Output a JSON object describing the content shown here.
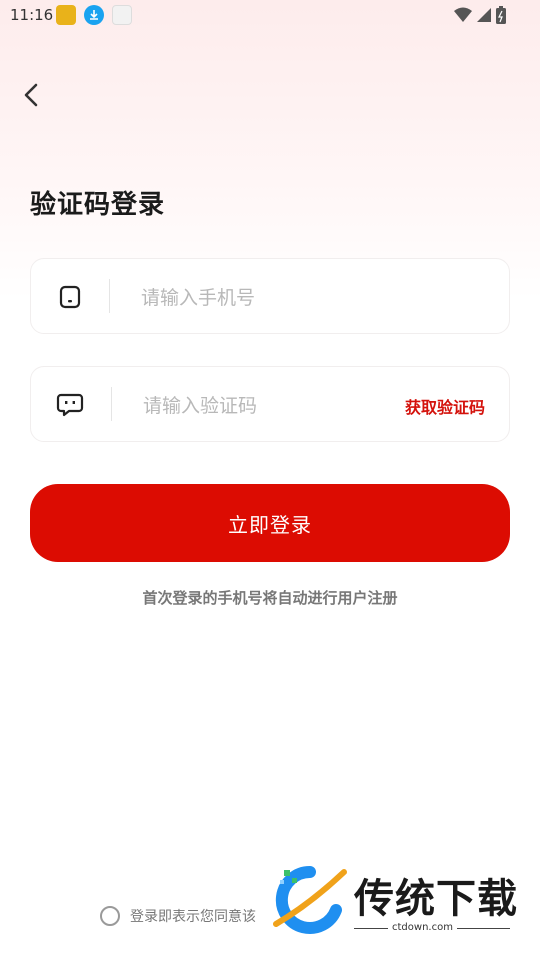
{
  "status_bar": {
    "time": "11:16",
    "notification_icons": [
      "app-badge-icon",
      "download-icon",
      "app-thumbnail-icon"
    ],
    "system_icons": [
      "wifi-icon",
      "signal-icon",
      "battery-icon"
    ]
  },
  "header": {
    "back_icon": "chevron-left-icon"
  },
  "page": {
    "title": "验证码登录"
  },
  "form": {
    "phone": {
      "icon": "phone-icon",
      "placeholder": "请输入手机号",
      "value": ""
    },
    "code": {
      "icon": "message-icon",
      "placeholder": "请输入验证码",
      "value": "",
      "get_code_label": "获取验证码"
    },
    "submit_label": "立即登录",
    "hint": "首次登录的手机号将自动进行用户注册"
  },
  "agreement": {
    "text": "登录即表示您同意该",
    "checked": false
  },
  "watermark": {
    "title": "传统下载",
    "url": "ctdown.com"
  },
  "colors": {
    "accent": "#dc0c02",
    "accent_text": "#d4120c",
    "placeholder": "#b8b8b8",
    "hint": "#777777"
  }
}
